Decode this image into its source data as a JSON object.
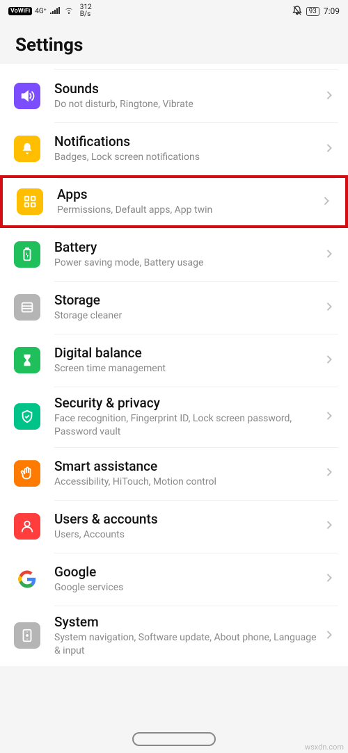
{
  "statusbar": {
    "vowifi": "VoWiFi",
    "net": "4G⁺",
    "speed_top": "312",
    "speed_bottom": "B/s",
    "battery": "93",
    "time": "7:09"
  },
  "header": {
    "title": "Settings"
  },
  "rows": [
    {
      "key": "sounds",
      "title": "Sounds",
      "sub": "Do not disturb, Ringtone, Vibrate",
      "color": "bg-purple",
      "icon": "sounds",
      "hl": false
    },
    {
      "key": "notifications",
      "title": "Notifications",
      "sub": "Badges, Lock screen notifications",
      "color": "bg-yellow",
      "icon": "bell",
      "hl": false
    },
    {
      "key": "apps",
      "title": "Apps",
      "sub": "Permissions, Default apps, App twin",
      "color": "bg-yellow",
      "icon": "grid",
      "hl": true
    },
    {
      "key": "battery",
      "title": "Battery",
      "sub": "Power saving mode, Battery usage",
      "color": "bg-green",
      "icon": "battery",
      "hl": false
    },
    {
      "key": "storage",
      "title": "Storage",
      "sub": "Storage cleaner",
      "color": "bg-gray",
      "icon": "storage",
      "hl": false
    },
    {
      "key": "digital",
      "title": "Digital balance",
      "sub": "Screen time management",
      "color": "bg-green",
      "icon": "hourglass",
      "hl": false
    },
    {
      "key": "security",
      "title": "Security & privacy",
      "sub": "Face recognition, Fingerprint ID, Lock screen password, Password vault",
      "color": "bg-teal",
      "icon": "shield",
      "hl": false
    },
    {
      "key": "smart",
      "title": "Smart assistance",
      "sub": "Accessibility, HiTouch, Motion control",
      "color": "bg-orange",
      "icon": "hand",
      "hl": false
    },
    {
      "key": "users",
      "title": "Users & accounts",
      "sub": "Users, Accounts",
      "color": "bg-red",
      "icon": "user",
      "hl": false
    },
    {
      "key": "google",
      "title": "Google",
      "sub": "Google services",
      "color": "google",
      "icon": "google",
      "hl": false
    },
    {
      "key": "system",
      "title": "System",
      "sub": "System navigation, Software update, About phone, Language & input",
      "color": "bg-gray",
      "icon": "system",
      "hl": false
    }
  ],
  "watermark": "wsxdn.com"
}
